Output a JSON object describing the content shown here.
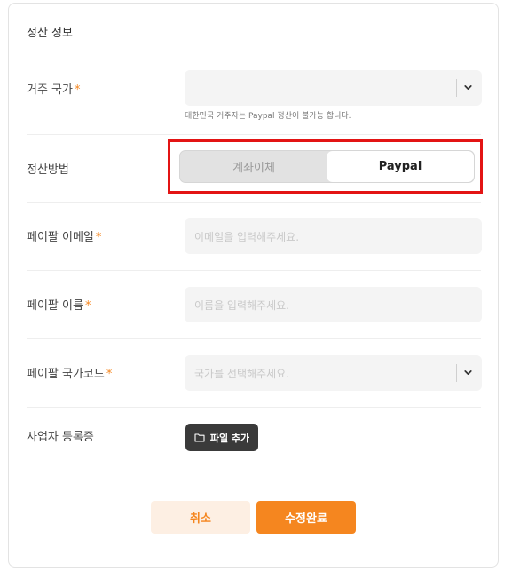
{
  "section_title": "정산 정보",
  "required_mark": "*",
  "residence": {
    "label": "거주 국가",
    "helper": "대한민국 거주자는 Paypal 정산이 불가능 합니다."
  },
  "payment_method": {
    "label": "정산방법",
    "options": [
      "계좌이체",
      "Paypal"
    ],
    "selected": "Paypal"
  },
  "paypal_email": {
    "label": "페이팔 이메일",
    "placeholder": "이메일을 입력해주세요."
  },
  "paypal_name": {
    "label": "페이팔 이름",
    "placeholder": "이름을 입력해주세요."
  },
  "paypal_country_code": {
    "label": "페이팔 국가코드",
    "placeholder": "국가를 선택해주세요."
  },
  "business_registration": {
    "label": "사업자 등록증",
    "button_label": "파일 추가",
    "icon": "folder-icon"
  },
  "actions": {
    "cancel_label": "취소",
    "submit_label": "수정완료"
  },
  "colors": {
    "accent": "#f5861f",
    "accent_light": "#fdefe3",
    "highlight": "#e31414",
    "dark_button": "#3a3a3a"
  }
}
